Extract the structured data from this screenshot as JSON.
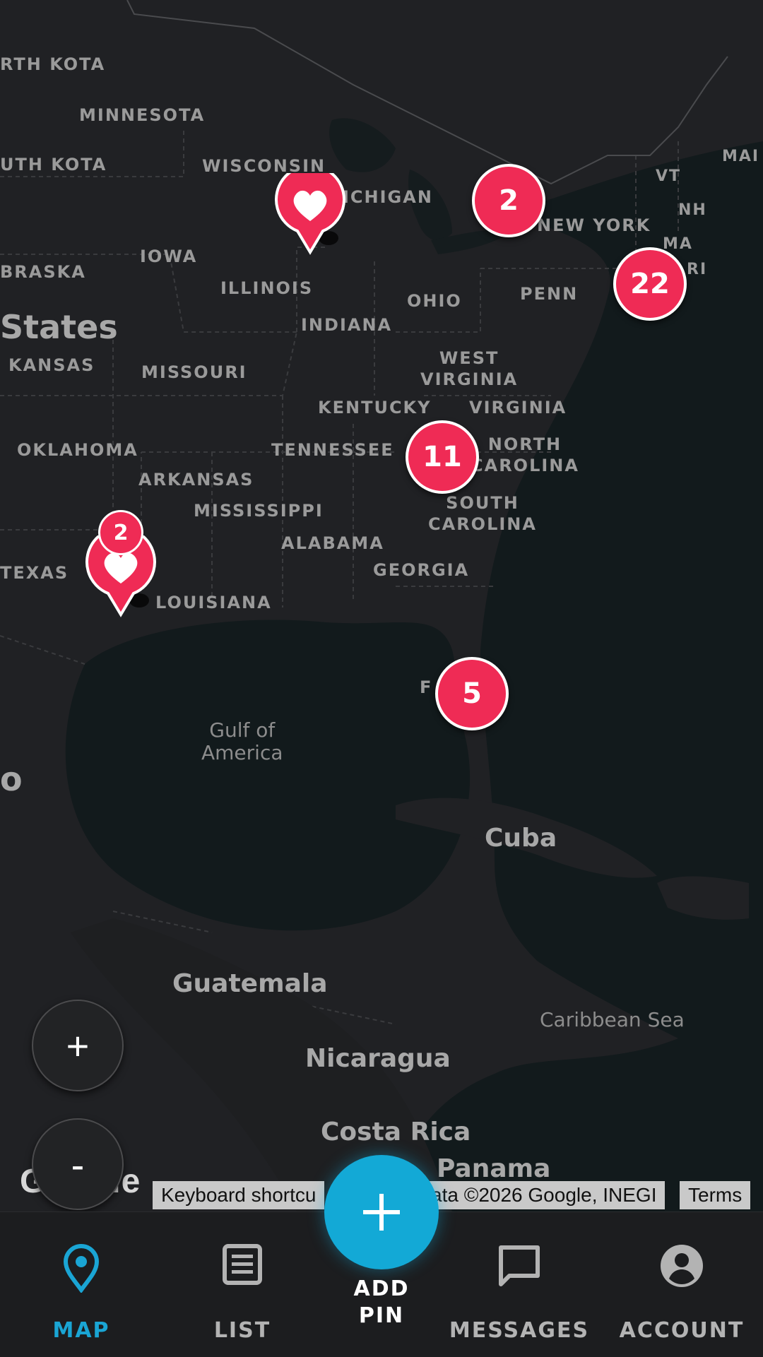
{
  "map": {
    "state_labels": [
      {
        "id": "north-dakota",
        "text": "RTH\nKOTA"
      },
      {
        "id": "minnesota",
        "text": "MINNESOTA"
      },
      {
        "id": "south-dakota",
        "text": "UTH\nKOTA"
      },
      {
        "id": "wisconsin",
        "text": "WISCONSIN"
      },
      {
        "id": "michigan",
        "text": "ICHIGAN"
      },
      {
        "id": "iowa",
        "text": "IOWA"
      },
      {
        "id": "nebraska",
        "text": "BRASKA"
      },
      {
        "id": "illinois",
        "text": "ILLINOIS"
      },
      {
        "id": "indiana",
        "text": "INDIANA"
      },
      {
        "id": "ohio",
        "text": "OHIO"
      },
      {
        "id": "penn",
        "text": "PENN"
      },
      {
        "id": "new-york",
        "text": "NEW YORK"
      },
      {
        "id": "kansas",
        "text": "KANSAS"
      },
      {
        "id": "missouri",
        "text": "MISSOURI"
      },
      {
        "id": "west-virginia",
        "text": "WEST\nVIRGINIA"
      },
      {
        "id": "kentucky",
        "text": "KENTUCKY"
      },
      {
        "id": "virginia",
        "text": "VIRGINIA"
      },
      {
        "id": "oklahoma",
        "text": "OKLAHOMA"
      },
      {
        "id": "tennessee",
        "text": "TENNESSEE"
      },
      {
        "id": "north-carolina",
        "text": "NORTH\nCAROLINA"
      },
      {
        "id": "arkansas",
        "text": "ARKANSAS"
      },
      {
        "id": "mississippi",
        "text": "MISSISSIPPI"
      },
      {
        "id": "south-carolina",
        "text": "SOUTH\nCAROLINA"
      },
      {
        "id": "alabama",
        "text": "ALABAMA"
      },
      {
        "id": "georgia",
        "text": "GEORGIA"
      },
      {
        "id": "texas",
        "text": "TEXAS"
      },
      {
        "id": "louisiana",
        "text": "LOUISIANA"
      },
      {
        "id": "florida",
        "text": "F"
      }
    ],
    "small_labels": [
      {
        "id": "vermont",
        "text": "VT"
      },
      {
        "id": "new-hampshire",
        "text": "NH"
      },
      {
        "id": "maine",
        "text": "MAI"
      },
      {
        "id": "massachusetts",
        "text": "MA"
      },
      {
        "id": "rhode-island",
        "text": "RI"
      }
    ],
    "country_labels": {
      "united_states": "States",
      "mexico": "o",
      "cuba": "Cuba",
      "guatemala": "Guatemala",
      "nicaragua": "Nicaragua",
      "costa_rica": "Costa Rica",
      "panama": "Panama"
    },
    "water_labels": {
      "gulf": "Gulf of\nAmerica",
      "caribbean": "Caribbean Sea"
    },
    "clusters": [
      {
        "id": "great-lakes",
        "count": "2"
      },
      {
        "id": "northeast",
        "count": "22"
      },
      {
        "id": "southeast",
        "count": "11"
      },
      {
        "id": "florida",
        "count": "5"
      }
    ],
    "pins": [
      {
        "id": "michigan",
        "badge": ""
      },
      {
        "id": "texas",
        "badge": "2"
      }
    ],
    "zoom_in_label": "+",
    "zoom_out_label": "-",
    "google_logo": "Google",
    "attribution": {
      "shortcuts": "Keyboard shortcu",
      "data": "ata ©2026 Google, INEGI",
      "terms": "Terms"
    }
  },
  "nav": {
    "map": "MAP",
    "list": "LIST",
    "add_pin": "ADD\nPIN",
    "messages": "MESSAGES",
    "account": "ACCOUNT"
  },
  "colors": {
    "accent": "#13a9d6",
    "active_nav": "#1aa5d4",
    "cluster": "#ef2b55",
    "map_land": "#202124",
    "map_water": "#11181a"
  }
}
